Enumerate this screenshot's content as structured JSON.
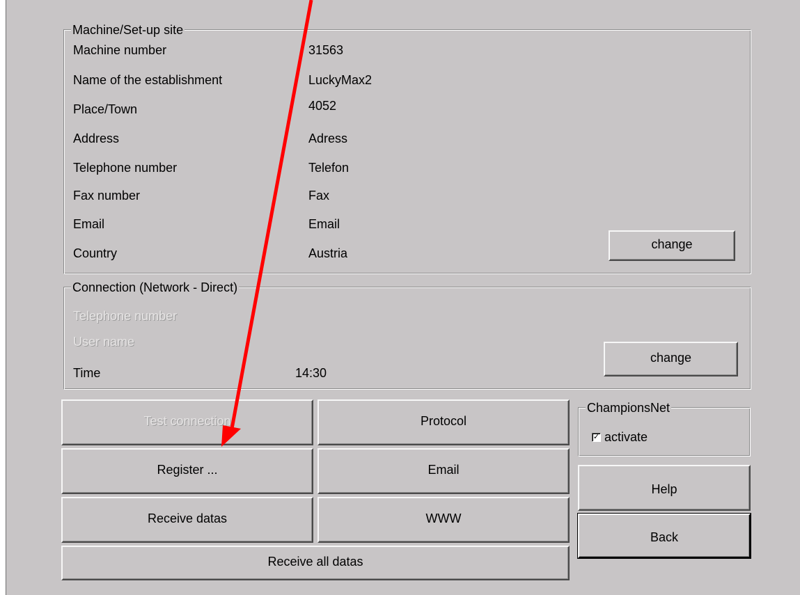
{
  "machine_site": {
    "legend": "Machine/Set-up site",
    "rows": [
      {
        "label": "Machine number",
        "value": "31563"
      },
      {
        "label": "Name of the establishment",
        "value": "LuckyMax2"
      },
      {
        "label": "Place/Town",
        "value": "4052"
      },
      {
        "label": "Address",
        "value": "Adress"
      },
      {
        "label": "Telephone number",
        "value": "Telefon"
      },
      {
        "label": "Fax number",
        "value": "Fax"
      },
      {
        "label": "Email",
        "value": "Email"
      },
      {
        "label": "Country",
        "value": "Austria"
      }
    ],
    "change_label": "change"
  },
  "connection": {
    "legend": "Connection (Network - Direct)",
    "telephone_label": "Telephone number",
    "user_label": "User name",
    "time_label": "Time",
    "time_value": "14:30",
    "change_label": "change"
  },
  "buttons": {
    "test_connection": "Test connection",
    "protocol": "Protocol",
    "register": "Register ...",
    "email": "Email",
    "receive_datas": "Receive datas",
    "www": "WWW",
    "receive_all": "Receive all datas",
    "help": "Help",
    "back": "Back"
  },
  "champions_net": {
    "legend": "ChampionsNet",
    "activate_label": "activate",
    "activate_checked": true
  },
  "annotation": {
    "arrow_color": "#ff0000"
  }
}
